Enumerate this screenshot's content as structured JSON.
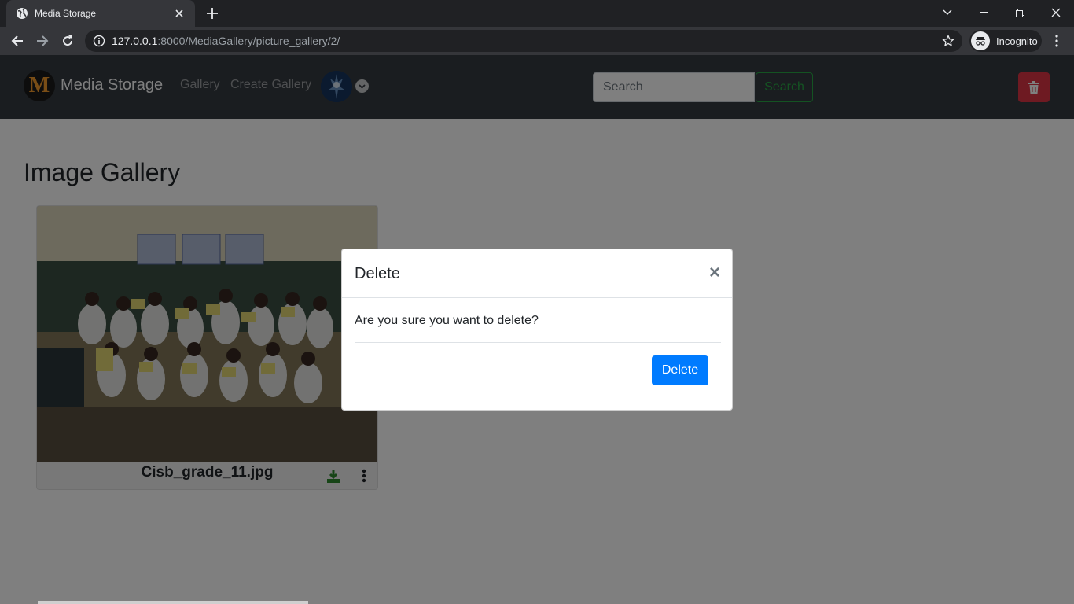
{
  "browser": {
    "tab_title": "Media Storage",
    "url_host": "127.0.0.1",
    "url_rest": ":8000/MediaGallery/picture_gallery/2/",
    "profile_label": "Incognito"
  },
  "navbar": {
    "brand_logo_letter": "M",
    "brand_name": "Media Storage",
    "links": [
      "Gallery",
      "Create Gallery"
    ],
    "search_placeholder": "Search",
    "search_button": "Search"
  },
  "main": {
    "title": "Image Gallery",
    "cards": [
      {
        "file_name": "Cisb_grade_11.jpg"
      }
    ]
  },
  "modal": {
    "title": "Delete",
    "close_symbol": "×",
    "message": "Are you sure you want to delete?",
    "delete_button": "Delete"
  },
  "colors": {
    "navbar_bg": "#343a40",
    "danger": "#dc3545",
    "success": "#28a745",
    "primary": "#007bff"
  }
}
